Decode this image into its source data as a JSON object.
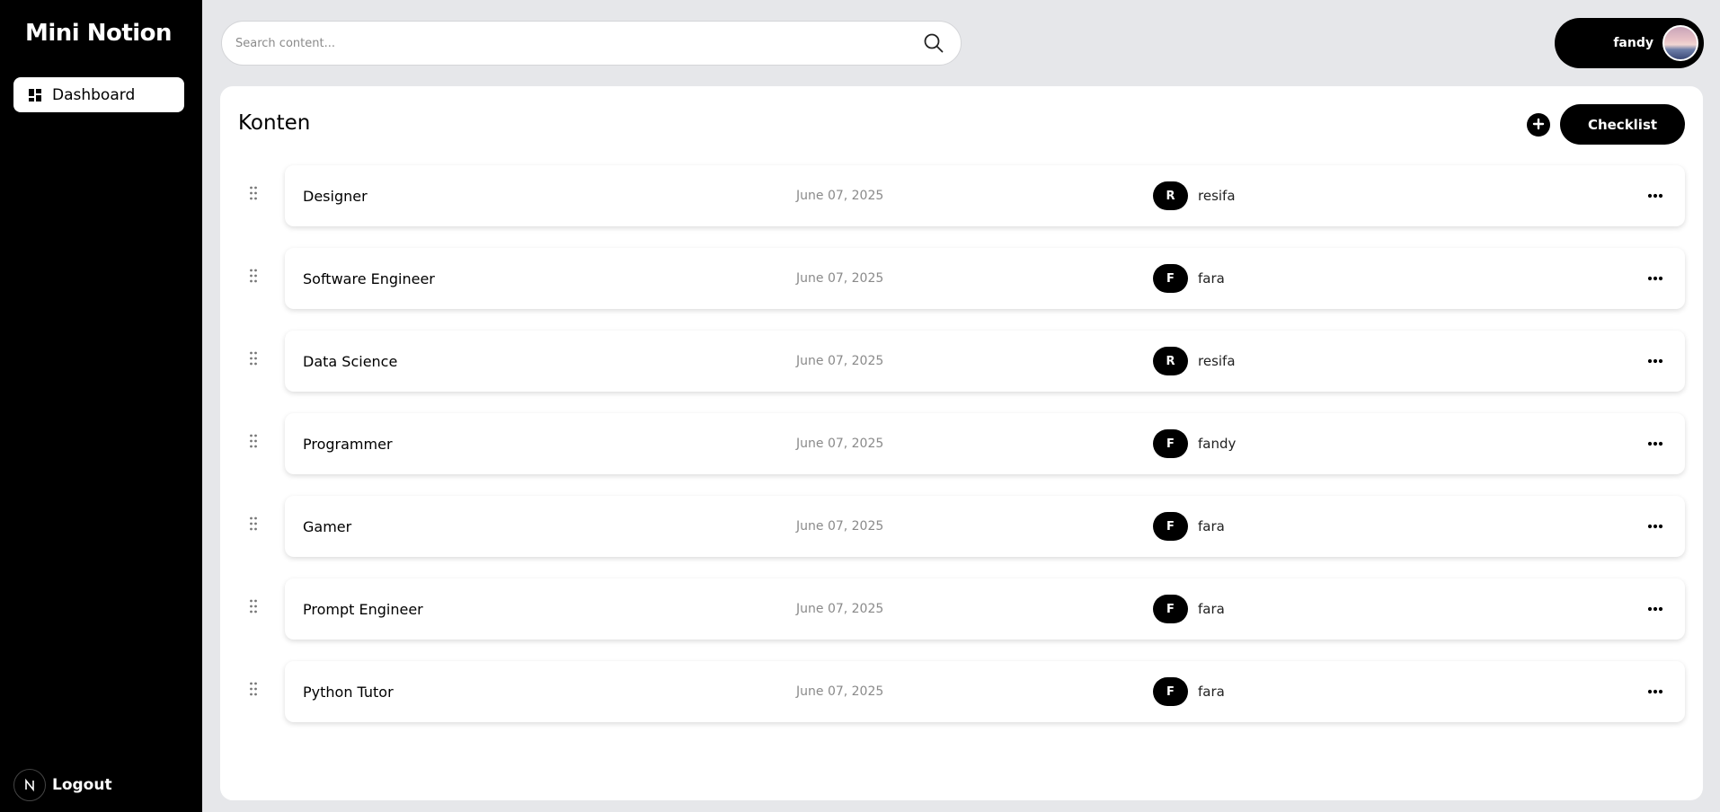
{
  "sidebar": {
    "brand": "Mini Notion",
    "nav": [
      {
        "label": "Dashboard",
        "icon": "dashboard-icon"
      }
    ],
    "logout_label": "Logout"
  },
  "header": {
    "search_placeholder": "Search content...",
    "user_name": "fandy"
  },
  "main": {
    "title": "Konten",
    "checklist_label": "Checklist",
    "items": [
      {
        "title": "Designer",
        "date": "June 07, 2025",
        "initial": "R",
        "owner": "resifa"
      },
      {
        "title": "Software Engineer",
        "date": "June 07, 2025",
        "initial": "F",
        "owner": "fara"
      },
      {
        "title": "Data Science",
        "date": "June 07, 2025",
        "initial": "R",
        "owner": "resifa"
      },
      {
        "title": "Programmer",
        "date": "June 07, 2025",
        "initial": "F",
        "owner": "fandy"
      },
      {
        "title": "Gamer",
        "date": "June 07, 2025",
        "initial": "F",
        "owner": "fara"
      },
      {
        "title": "Prompt Engineer",
        "date": "June 07, 2025",
        "initial": "F",
        "owner": "fara"
      },
      {
        "title": "Python Tutor",
        "date": "June 07, 2025",
        "initial": "F",
        "owner": "fara"
      }
    ]
  },
  "colors": {
    "sidebar_bg": "#000000",
    "page_bg": "#e6e7ea",
    "accent": "#000000",
    "date_text": "#8a8a8a"
  }
}
